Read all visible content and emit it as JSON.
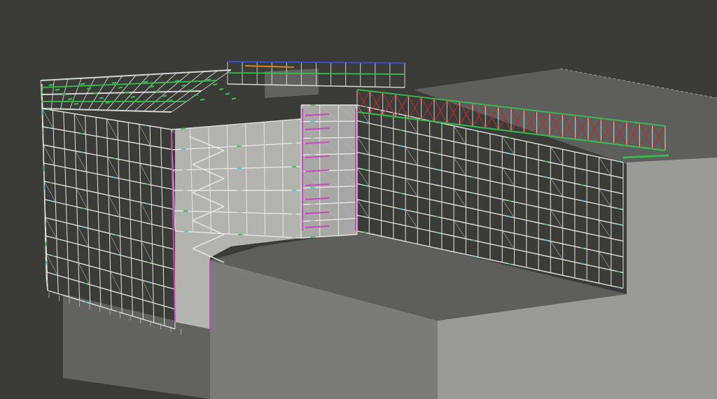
{
  "viewport": {
    "background_color": "#3b3b37"
  },
  "scene": {
    "building_colors": {
      "top": "#5e5e5c",
      "side_light": "#9a9b98",
      "side_mid": "#7b7b79",
      "side_dark": "#626260",
      "inner_light": "#c9c9c6",
      "inner_mid": "#b4b4b1"
    },
    "scaffold_colors": {
      "tube": "#e6e6e3",
      "tube_dim": "#b8b8b6",
      "deck_green": "#33c04a",
      "brace_red": "#b33030",
      "accent_magenta": "#d03cc8",
      "accent_cyan": "#3fc9d6",
      "accent_blue": "#3b4fd8",
      "accent_orange": "#e08a2a"
    }
  }
}
